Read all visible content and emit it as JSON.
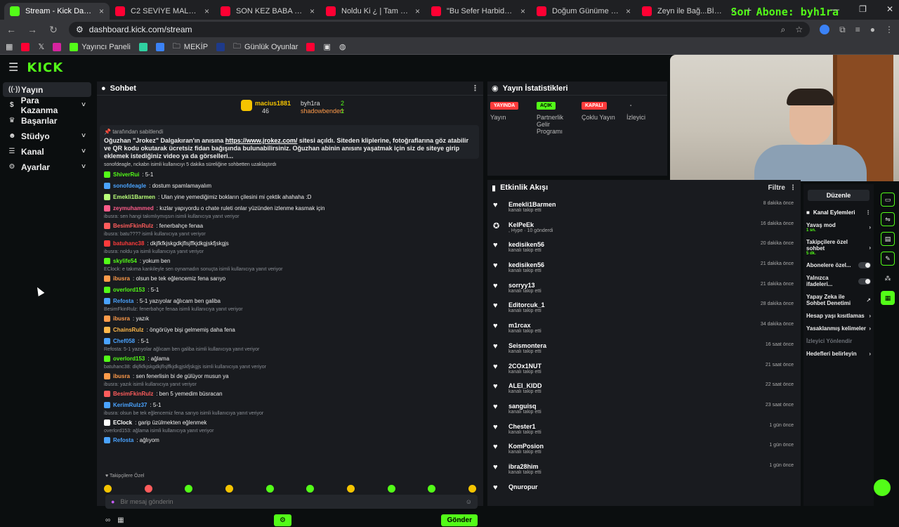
{
  "browser": {
    "tabs": [
      {
        "title": "Stream - Kick Dashboard",
        "favicon": "kick",
        "active": true
      },
      {
        "title": "C2 SEVİYE MALLAR - YouTube",
        "favicon": "youtube",
        "active": false
      },
      {
        "title": "SON KEZ BABA MRB... | Madara",
        "favicon": "youtube",
        "active": false
      },
      {
        "title": "Noldu Ki ¿ | Tam Çerezlik | #247",
        "favicon": "youtube",
        "active": false
      },
      {
        "title": "\"Bu Sefer Harbiden Komik\" Kick",
        "favicon": "youtube",
        "active": false
      },
      {
        "title": "Doğum Günüme Özel | Ruddy",
        "favicon": "youtube",
        "active": false
      },
      {
        "title": "Zeyn ile Bağ...BİTİRMECE | FİN...",
        "favicon": "youtube",
        "active": false
      }
    ],
    "overlay_text": "Son Abone: byh1ra",
    "url": "dashboard.kick.com/stream",
    "bookmarks": [
      "Yayıncı Paneli",
      "MEKİP",
      "Günlük Oyunlar"
    ]
  },
  "app": {
    "logo": "KICK",
    "sidebar": [
      {
        "label": "Yayın",
        "icon": "broadcast-icon",
        "active": true,
        "chev": ""
      },
      {
        "label": "Para Kazanma",
        "icon": "money-icon",
        "active": false,
        "chev": "˅"
      },
      {
        "label": "Başarılar",
        "icon": "trophy-icon",
        "active": false,
        "chev": ""
      },
      {
        "label": "Stüdyo",
        "icon": "studio-icon",
        "active": false,
        "chev": "˅"
      },
      {
        "label": "Kanal",
        "icon": "channel-icon",
        "active": false,
        "chev": "˅"
      },
      {
        "label": "Ayarlar",
        "icon": "settings-icon",
        "active": false,
        "chev": "˅"
      }
    ],
    "chat": {
      "title": "Sohbet",
      "leaders": {
        "left_name": "macius1881",
        "left_count": "46",
        "right1": "byh1ra",
        "right1_count": "2",
        "right2": "shadowbenderr",
        "right2_count": "1"
      },
      "pinned_by": "tarafından sabitlendi",
      "pinned_text_1": "Oğuzhan \"Jrokez\" Dalgakıran'ın anısına ",
      "pinned_link": "https://www.jrokez.com/",
      "pinned_text_2": " sitesi açıldı. Siteden kliplerine, fotoğraflarına göz atabilir ve QR kodu okutarak ücretsiz fidan bağışında bulunabilirsiniz. Oğuzhan abinin anısını yaşatmak için siz de siteye girip eklemek istediğiniz video ya da görselleri...",
      "lines": [
        {
          "type": "sys",
          "user": "",
          "text": "sonofdeagle, nckabn isimli kullanıcıyı 5 dakika süreliğine sohbetten uzaklaştırdı",
          "color": "#ddd"
        },
        {
          "type": "msg",
          "user": "ShiverRui",
          "text": ": 5-1",
          "color": "#53fc18"
        },
        {
          "type": "msg",
          "user": "sonofdeagle",
          "text": ": dostum spamlamayalım",
          "color": "#4aa3ff"
        },
        {
          "type": "msg",
          "user": "Emekli1Barmen",
          "text": ": Ulan yine yemediğimiz bokların çilesini mi çektik ahahaha :D",
          "color": "#b9ff7a"
        },
        {
          "type": "msg",
          "user": "zeymuhammed",
          "text": ": kızlar yapıyordu o chate ruleti onlar yüzünden izlenme kasmak için",
          "color": "#ff5c8a"
        },
        {
          "type": "reply",
          "user": "",
          "text": "ibusra: sen hangi takımlıymışsın isimli kullanıcıya yanıt veriyor",
          "color": "#8a8f96"
        },
        {
          "type": "msg",
          "user": "BesimFkinRulz",
          "text": ": fenerbahçe fenaa",
          "color": "#ff5c5c"
        },
        {
          "type": "reply",
          "user": "",
          "text": "ibusra: batu???? isimli kullanıcıya yanıt veriyor",
          "color": "#8a8f96"
        },
        {
          "type": "msg",
          "user": "batuhanc38",
          "text": ": dkjfkfkjskgdkjflsjffkjdkgjskfjskgjs",
          "color": "#ff3b3b"
        },
        {
          "type": "reply",
          "user": "",
          "text": "ibusra: noldu ya isimli kullanıcıya yanıt veriyor",
          "color": "#8a8f96"
        },
        {
          "type": "msg",
          "user": "skylife54",
          "text": ": yokum ben",
          "color": "#53fc18"
        },
        {
          "type": "reply",
          "user": "",
          "text": "EClock: e takıma kankileyle sen oynamadın sonuçta isimli kullanıcıya yanıt veriyor",
          "color": "#8a8f96"
        },
        {
          "type": "msg",
          "user": "ibusra",
          "text": ": olsun be tek eğlencemiz fena sarıyo",
          "color": "#ff9b4a"
        },
        {
          "type": "msg",
          "user": "overlord153",
          "text": ": 5-1",
          "color": "#53fc18"
        },
        {
          "type": "msg",
          "user": "Refosta",
          "text": ": 5-1 yazıyolar ağlıcam ben galiba",
          "color": "#4aa3ff"
        },
        {
          "type": "reply",
          "user": "",
          "text": "BesimFkinRulz: fenerbahçe fenaa isimli kullanıcıya yanıt veriyor",
          "color": "#8a8f96"
        },
        {
          "type": "msg",
          "user": "ibusra",
          "text": ": yazık",
          "color": "#ff9b4a"
        },
        {
          "type": "msg",
          "user": "ChainsRulz",
          "text": ": öngörüye bişi gelmemiş daha fena",
          "color": "#ffb84a"
        },
        {
          "type": "msg",
          "user": "Chef058",
          "text": ": 5-1",
          "color": "#4aa3ff"
        },
        {
          "type": "reply",
          "user": "",
          "text": "Refosta: 5-1 yazıyolar ağlıcam ben galiba isimli kullanıcıya yanıt veriyor",
          "color": "#8a8f96"
        },
        {
          "type": "msg",
          "user": "overlord153",
          "text": ": ağlama",
          "color": "#53fc18"
        },
        {
          "type": "reply",
          "user": "",
          "text": "batuhanc38: dkjfkfkjskgdkjflsjffkjdkgjskfjskgjs isimli kullanıcıya yanıt veriyor",
          "color": "#8a8f96"
        },
        {
          "type": "msg",
          "user": "ibusra",
          "text": ": sen fenerlisin bi de gülüyor musun ya",
          "color": "#ff9b4a"
        },
        {
          "type": "reply",
          "user": "",
          "text": "ibusra: yazık isimli kullanıcıya yanıt veriyor",
          "color": "#8a8f96"
        },
        {
          "type": "msg",
          "user": "BesimFkinRulz",
          "text": ": ben 5 yemedim büsracan",
          "color": "#ff5c5c"
        },
        {
          "type": "msg",
          "user": "KerimRulz37",
          "text": ": 5-1",
          "color": "#4aa3ff"
        },
        {
          "type": "reply",
          "user": "",
          "text": "ibusra: olsun be tek eğlencemiz fena sarıyo isimli kullanıcıya yanıt veriyor",
          "color": "#8a8f96"
        },
        {
          "type": "msg",
          "user": "EClock",
          "text": ": garip üzülmekten eğlenmek",
          "color": "#ffffff"
        },
        {
          "type": "reply",
          "user": "",
          "text": "overlord153: ağlama isimli kullanıcıya yanıt veriyor",
          "color": "#8a8f96"
        },
        {
          "type": "msg",
          "user": "Refosta",
          "text": ": ağlıyom",
          "color": "#4aa3ff"
        }
      ],
      "followers_only_label": "Takipçilere Özel",
      "input_placeholder": "Bir mesaj gönderin",
      "send_label": "Gönder"
    },
    "stats": {
      "title": "Yayın İstatistikleri",
      "cols": [
        {
          "pill": "YAYINDA",
          "pill_color": "#ff3b3b",
          "label": "Yayın"
        },
        {
          "pill": "AÇIK",
          "pill_color": "#53fc18",
          "label": "Partnerlik Gelir Programı"
        },
        {
          "pill": "KAPALI",
          "pill_color": "#ff3b3b",
          "label": "Çoklu Yayın"
        },
        {
          "pill": "-",
          "pill_color": "",
          "label": "İzleyici"
        }
      ]
    },
    "activity": {
      "title": "Etkinlik Akışı",
      "filter_label": "Filtre",
      "items": [
        {
          "name": "Emekli1Barmen",
          "sub": "kanalı takip etti",
          "time": "8 dakika önce"
        },
        {
          "name": "KelPeEk",
          "sub": ", Hype · 10 gönderdi",
          "time": "16 dakika önce"
        },
        {
          "name": "kedisiken56",
          "sub": "kanalı takip etti",
          "time": "20 dakika önce"
        },
        {
          "name": "kedisiken56",
          "sub": "kanalı takip etti",
          "time": "21 dakika önce"
        },
        {
          "name": "sorryy13",
          "sub": "kanalı takip etti",
          "time": "21 dakika önce"
        },
        {
          "name": "Editorcuk_1",
          "sub": "kanalı takip etti",
          "time": "28 dakika önce"
        },
        {
          "name": "m1rcax",
          "sub": "kanalı takip etti",
          "time": "34 dakika önce"
        },
        {
          "name": "Seismontera",
          "sub": "kanalı takip etti",
          "time": "16 saat önce"
        },
        {
          "name": "2COx1NUT",
          "sub": "kanalı takip etti",
          "time": "21 saat önce"
        },
        {
          "name": "ALEI_KIDD",
          "sub": "kanalı takip etti",
          "time": "22 saat önce"
        },
        {
          "name": "sanguisq",
          "sub": "kanalı takip etti",
          "time": "23 saat önce"
        },
        {
          "name": "Chester1",
          "sub": "kanalı takip etti",
          "time": "1 gün önce"
        },
        {
          "name": "KomPosion",
          "sub": "kanalı takip etti",
          "time": "1 gün önce"
        },
        {
          "name": "ibra28him",
          "sub": "kanalı takip etti",
          "time": "1 gün önce"
        },
        {
          "name": "Qnuropur",
          "sub": "",
          "time": ""
        }
      ]
    },
    "channel_actions": {
      "edit_label": "Düzenle",
      "title": "Kanal Eylemleri",
      "items": [
        {
          "label": "Yavaş mod",
          "small": "1 sn.",
          "control": "chev"
        },
        {
          "label": "Takipçilere özel sohbet",
          "small": "5 dk.",
          "control": "chev"
        },
        {
          "label": "Abonelere özel...",
          "small": "",
          "control": "toggle"
        },
        {
          "label": "Yalnızca ifadeleri...",
          "small": "",
          "control": "toggle"
        },
        {
          "label": "Yapay Zeka ile Sohbet Denetimi",
          "small": "",
          "control": "ext"
        },
        {
          "label": "Hesap yaşı kısıtlamas",
          "small": "",
          "control": "chev"
        },
        {
          "label": "Yasaklanmış kelimeler",
          "small": "",
          "control": "chev"
        },
        {
          "label": "İzleyici Yönlendir",
          "small": "",
          "control": "none"
        },
        {
          "label": "Hedefleri belirleyin",
          "small": "",
          "control": "chev"
        }
      ]
    }
  }
}
